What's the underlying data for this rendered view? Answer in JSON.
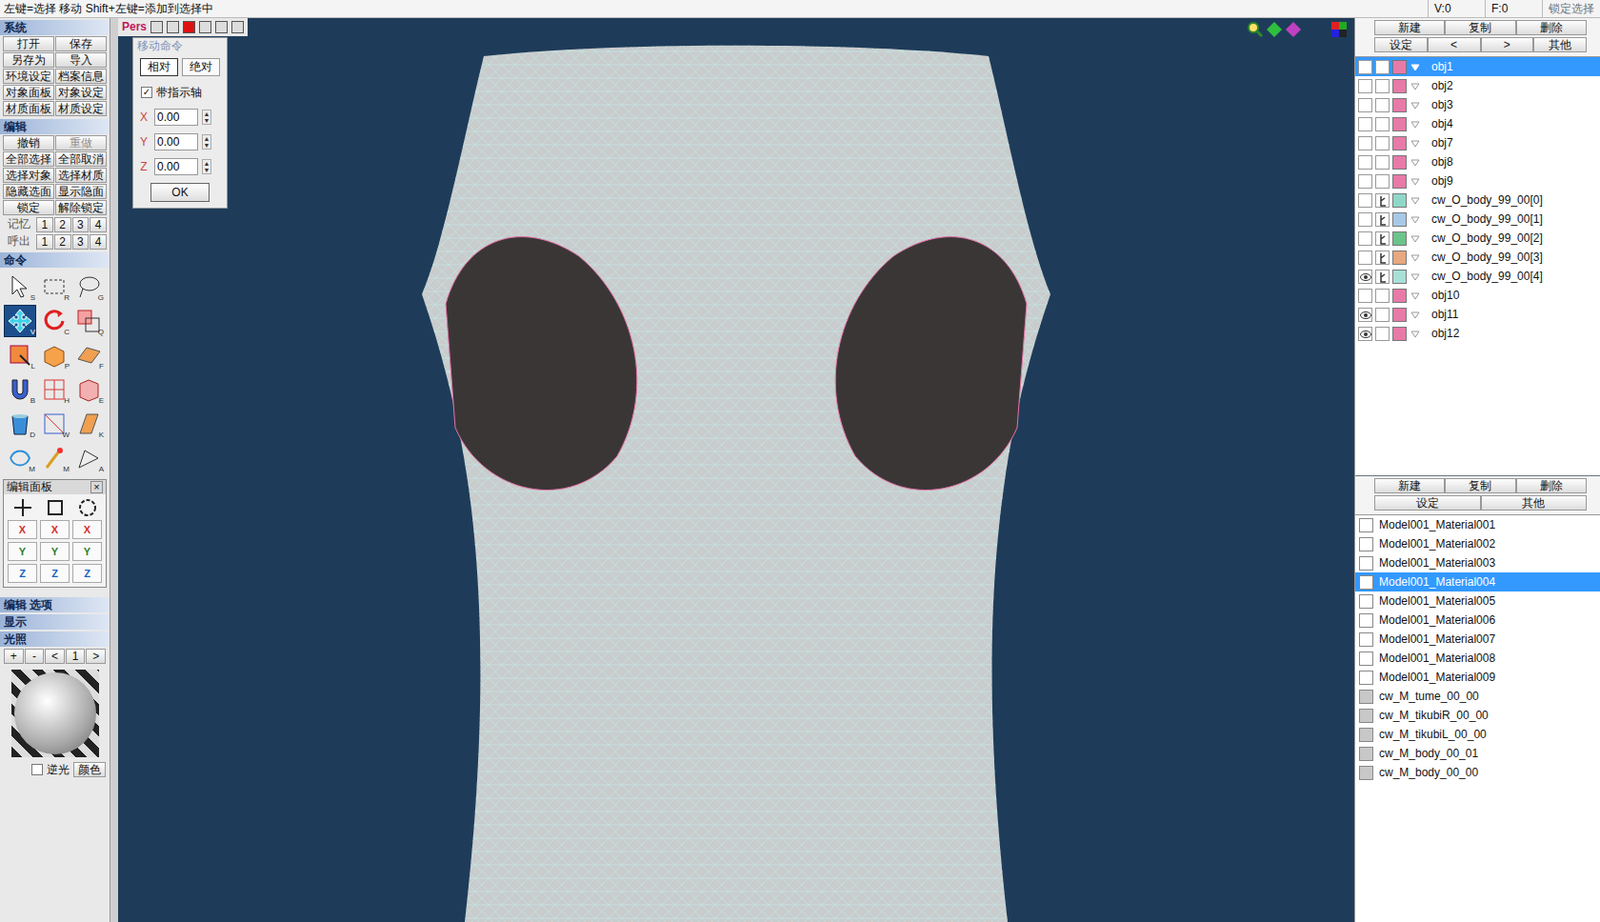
{
  "status_bar": {
    "hint": "左键=选择 移动 Shift+左键=添加到选择中",
    "vertex": "V:0",
    "face": "F:0",
    "lock": "锁定选择"
  },
  "system": {
    "title": "系统",
    "buttons": [
      {
        "label": "打开",
        "disabled": false
      },
      {
        "label": "保存",
        "disabled": false
      },
      {
        "label": "另存为",
        "disabled": false
      },
      {
        "label": "导入",
        "disabled": false
      },
      {
        "label": "环境设定",
        "disabled": false
      },
      {
        "label": "档案信息",
        "disabled": false
      },
      {
        "label": "对象面板",
        "disabled": false
      },
      {
        "label": "对象设定",
        "disabled": false
      },
      {
        "label": "材质面板",
        "disabled": false
      },
      {
        "label": "材质设定",
        "disabled": false
      }
    ]
  },
  "edit": {
    "title": "编辑",
    "buttons": [
      {
        "label": "撤销",
        "disabled": false
      },
      {
        "label": "重做",
        "disabled": true
      },
      {
        "label": "全部选择",
        "disabled": false
      },
      {
        "label": "全部取消",
        "disabled": false
      },
      {
        "label": "选择对象",
        "disabled": false
      },
      {
        "label": "选择材质",
        "disabled": false
      },
      {
        "label": "隐藏选面",
        "disabled": false
      },
      {
        "label": "显示隐面",
        "disabled": false
      },
      {
        "label": "锁定",
        "disabled": false
      },
      {
        "label": "解除锁定",
        "disabled": false
      }
    ],
    "memory": {
      "label": "记忆",
      "slots": [
        "1",
        "2",
        "3",
        "4"
      ]
    },
    "recall": {
      "label": "呼出",
      "slots": [
        "1",
        "2",
        "3",
        "4"
      ]
    }
  },
  "command": {
    "title": "命令",
    "tools": [
      {
        "key": "S",
        "selected": false
      },
      {
        "key": "R",
        "selected": false
      },
      {
        "key": "G",
        "selected": false
      },
      {
        "key": "V",
        "selected": true
      },
      {
        "key": "C",
        "selected": false
      },
      {
        "key": "Q",
        "selected": false
      },
      {
        "key": "L",
        "selected": false
      },
      {
        "key": "P",
        "selected": false
      },
      {
        "key": "F",
        "selected": false
      },
      {
        "key": "B",
        "selected": false
      },
      {
        "key": "H",
        "selected": false
      },
      {
        "key": "E",
        "selected": false
      },
      {
        "key": "D",
        "selected": false
      },
      {
        "key": "W",
        "selected": false
      },
      {
        "key": "K",
        "selected": false
      },
      {
        "key": "M",
        "selected": false
      },
      {
        "key": "M",
        "selected": false
      },
      {
        "key": "A",
        "selected": false
      }
    ]
  },
  "edit_panel": {
    "title": "编辑面板",
    "close": "×",
    "rows": [
      [
        "X",
        "X",
        "X"
      ],
      [
        "Y",
        "Y",
        "Y"
      ],
      [
        "Z",
        "Z",
        "Z"
      ]
    ]
  },
  "options": {
    "title": "编辑 选项"
  },
  "display": {
    "title": "显示"
  },
  "lighting": {
    "title": "光照",
    "controls": [
      "+",
      "-",
      "<",
      "1",
      ">"
    ],
    "backlight": {
      "label": "逆光",
      "checked": false
    },
    "color_button": "颜色"
  },
  "viewport": {
    "mode": "Pers"
  },
  "move_dialog": {
    "title": "移动命令",
    "tabs": [
      {
        "label": "相对",
        "selected": true
      },
      {
        "label": "绝对",
        "selected": false
      }
    ],
    "show_axis": {
      "label": "带指示轴",
      "checked": true
    },
    "fields": [
      {
        "axis": "X",
        "value": "0.00"
      },
      {
        "axis": "Y",
        "value": "0.00"
      },
      {
        "axis": "Z",
        "value": "0.00"
      }
    ],
    "ok": "OK"
  },
  "objects_panel": {
    "buttons": [
      "新建",
      "复制",
      "删除"
    ],
    "buttons2": [
      "设定",
      "<",
      ">",
      "其他"
    ],
    "items": [
      {
        "name": "obj1",
        "visible": false,
        "locked": false,
        "color": "#e87aa8",
        "selected": true
      },
      {
        "name": "obj2",
        "visible": false,
        "locked": false,
        "color": "#e87aa8",
        "selected": false
      },
      {
        "name": "obj3",
        "visible": false,
        "locked": false,
        "color": "#e87aa8",
        "selected": false
      },
      {
        "name": "obj4",
        "visible": false,
        "locked": false,
        "color": "#e87aa8",
        "selected": false
      },
      {
        "name": "obj7",
        "visible": false,
        "locked": false,
        "color": "#e87aa8",
        "selected": false
      },
      {
        "name": "obj8",
        "visible": false,
        "locked": false,
        "color": "#e87aa8",
        "selected": false
      },
      {
        "name": "obj9",
        "visible": false,
        "locked": false,
        "color": "#e87aa8",
        "selected": false
      },
      {
        "name": "cw_O_body_99_00[0]",
        "visible": false,
        "locked": true,
        "color": "#8fd8c8",
        "selected": false
      },
      {
        "name": "cw_O_body_99_00[1]",
        "visible": false,
        "locked": true,
        "color": "#a8c8e8",
        "selected": false
      },
      {
        "name": "cw_O_body_99_00[2]",
        "visible": false,
        "locked": true,
        "color": "#6cc48a",
        "selected": false
      },
      {
        "name": "cw_O_body_99_00[3]",
        "visible": false,
        "locked": true,
        "color": "#e8a880",
        "selected": false
      },
      {
        "name": "cw_O_body_99_00[4]",
        "visible": true,
        "locked": true,
        "color": "#a8e0d8",
        "selected": false
      },
      {
        "name": "obj10",
        "visible": false,
        "locked": false,
        "color": "#e87aa8",
        "selected": false
      },
      {
        "name": "obj11",
        "visible": true,
        "locked": false,
        "color": "#e87aa8",
        "selected": false
      },
      {
        "name": "obj12",
        "visible": true,
        "locked": false,
        "color": "#e87aa8",
        "selected": false
      }
    ]
  },
  "materials_panel": {
    "buttons": [
      "新建",
      "复制",
      "删除"
    ],
    "buttons2": [
      "设定",
      "其他"
    ],
    "items": [
      {
        "name": "Model001_Material001",
        "selected": false,
        "kind": "plain"
      },
      {
        "name": "Model001_Material002",
        "selected": false,
        "kind": "plain"
      },
      {
        "name": "Model001_Material003",
        "selected": false,
        "kind": "plain"
      },
      {
        "name": "Model001_Material004",
        "selected": true,
        "kind": "plain"
      },
      {
        "name": "Model001_Material005",
        "selected": false,
        "kind": "plain"
      },
      {
        "name": "Model001_Material006",
        "selected": false,
        "kind": "plain"
      },
      {
        "name": "Model001_Material007",
        "selected": false,
        "kind": "plain"
      },
      {
        "name": "Model001_Material008",
        "selected": false,
        "kind": "plain"
      },
      {
        "name": "Model001_Material009",
        "selected": false,
        "kind": "plain"
      },
      {
        "name": "cw_M_tume_00_00",
        "selected": false,
        "kind": "textured"
      },
      {
        "name": "cw_M_tikubiR_00_00",
        "selected": false,
        "kind": "textured"
      },
      {
        "name": "cw_M_tikubiL_00_00",
        "selected": false,
        "kind": "textured"
      },
      {
        "name": "cw_M_body_00_01",
        "selected": false,
        "kind": "textured"
      },
      {
        "name": "cw_M_body_00_00",
        "selected": false,
        "kind": "textured"
      }
    ]
  }
}
